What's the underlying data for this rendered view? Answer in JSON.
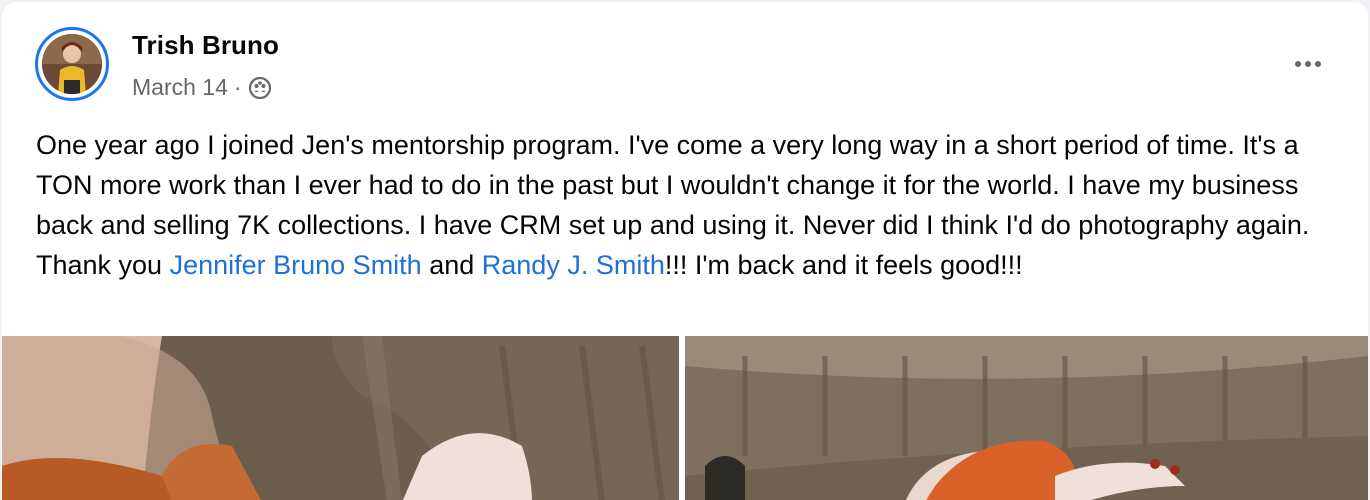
{
  "post": {
    "author": "Trish Bruno",
    "date": "March 14",
    "separator": "·",
    "audience_icon": "friends-icon",
    "more_icon": "more-options-icon",
    "text_segments": {
      "part1": "One year ago I joined Jen's mentorship program. I've come a very long way in a short period of time. It's a TON more work than I ever had to do in the past but I wouldn't change it for the world. I have my business back and selling 7K collections. I have CRM set up and using it. Never did I think I'd do photography again. Thank you ",
      "mention1": "Jennifer Bruno Smith",
      "part2": " and ",
      "mention2": "Randy J. Smith",
      "part3": "!!! I'm back and it feels good!!!"
    },
    "photo_count": 2
  },
  "colors": {
    "link": "#216fdb",
    "secondary_text": "#65676b",
    "avatar_ring": "#1877f2"
  }
}
